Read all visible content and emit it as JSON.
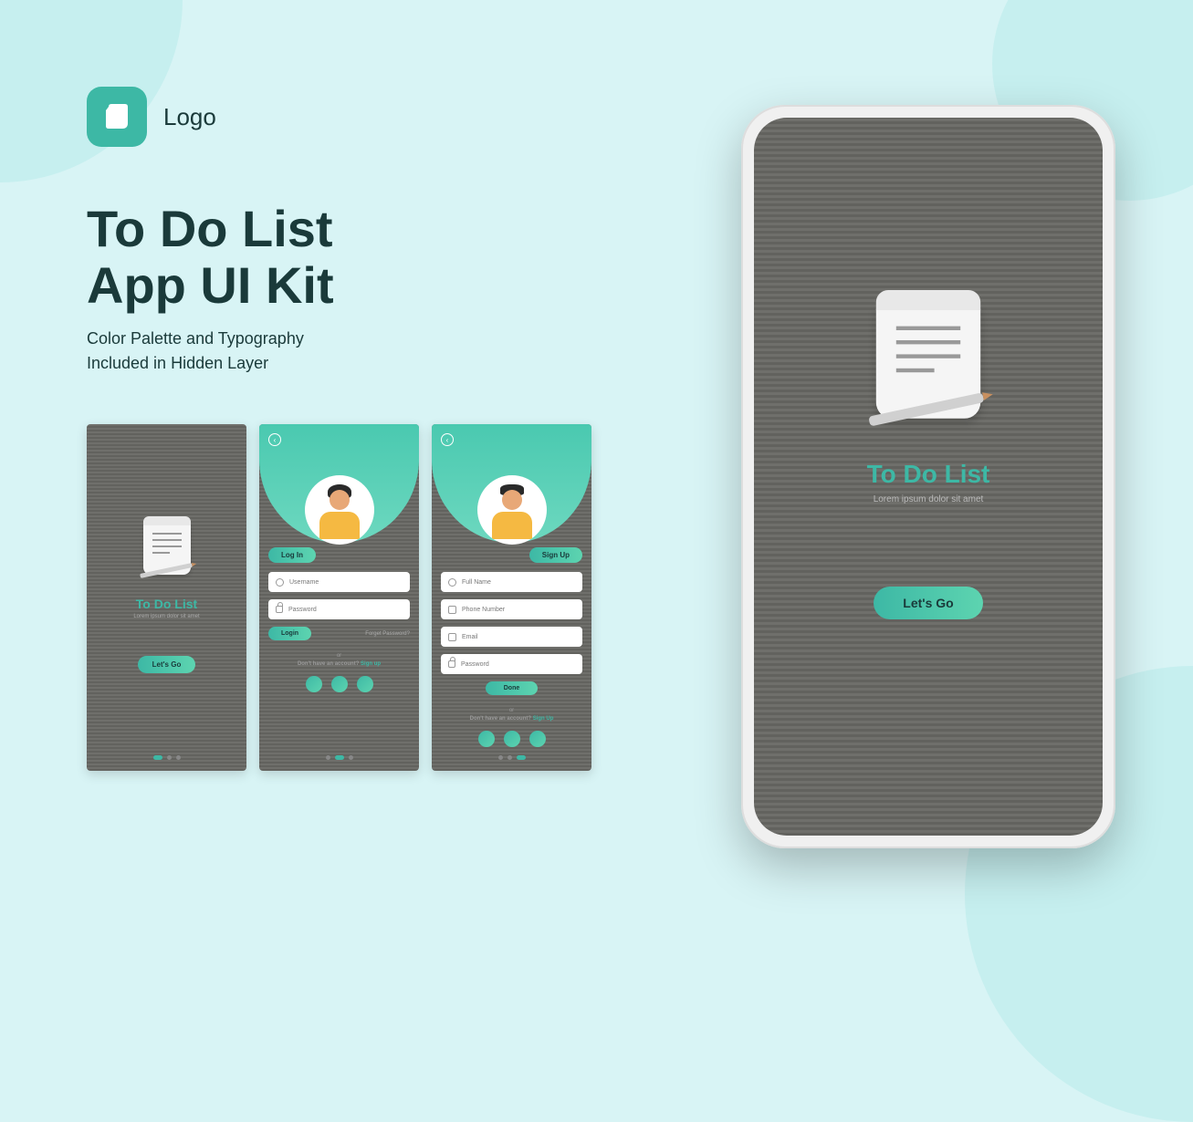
{
  "logo": {
    "text": "Logo"
  },
  "headline": {
    "line1": "To Do List",
    "line2": "App UI Kit"
  },
  "subhead": {
    "line1": "Color Palette and Typography",
    "line2": "Included in Hidden Layer"
  },
  "splash": {
    "title": "To Do List",
    "subtitle": "Lorem ipsum dolor sit amet",
    "cta": "Let's Go"
  },
  "login": {
    "tab": "Log In",
    "fields": {
      "username": "Username",
      "password": "Password"
    },
    "button": "Login",
    "forgot": "Forget Password?",
    "or": "or",
    "noAccount": "Don't have an account?",
    "signup": "Sign up"
  },
  "signup": {
    "tab": "Sign Up",
    "fields": {
      "fullname": "Full Name",
      "phone": "Phone Number",
      "email": "Email",
      "password": "Password"
    },
    "button": "Done",
    "or": "or",
    "noAccount": "Don't have an account?",
    "signup": "Sign Up"
  },
  "phone": {
    "title": "To Do List",
    "subtitle": "Lorem ipsum dolor sit amet",
    "cta": "Let's Go"
  }
}
